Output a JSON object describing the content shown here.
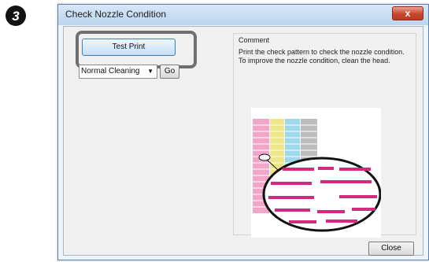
{
  "step_number": "3",
  "window": {
    "title": "Check Nozzle Condition",
    "close_glyph": "x"
  },
  "left_panel": {
    "test_print_label": "Test Print",
    "cleaning_select_value": "Normal Cleaning",
    "go_label": "Go"
  },
  "comment": {
    "heading": "Comment",
    "lines": [
      "Print the check pattern to check the nozzle condition.",
      "To improve the nozzle condition, clean the head."
    ]
  },
  "footer": {
    "close_label": "Close"
  },
  "colors": {
    "cyan_ink": "#9fd8ea",
    "magenta_ink": "#d8277f",
    "yellow_ink": "#efe58a",
    "black_ink": "#8c8c8c",
    "badge": "#111111"
  },
  "icons": {
    "step_badge": "circled-number-icon",
    "select_arrow": "chevron-down-icon",
    "window_close": "close-icon"
  }
}
